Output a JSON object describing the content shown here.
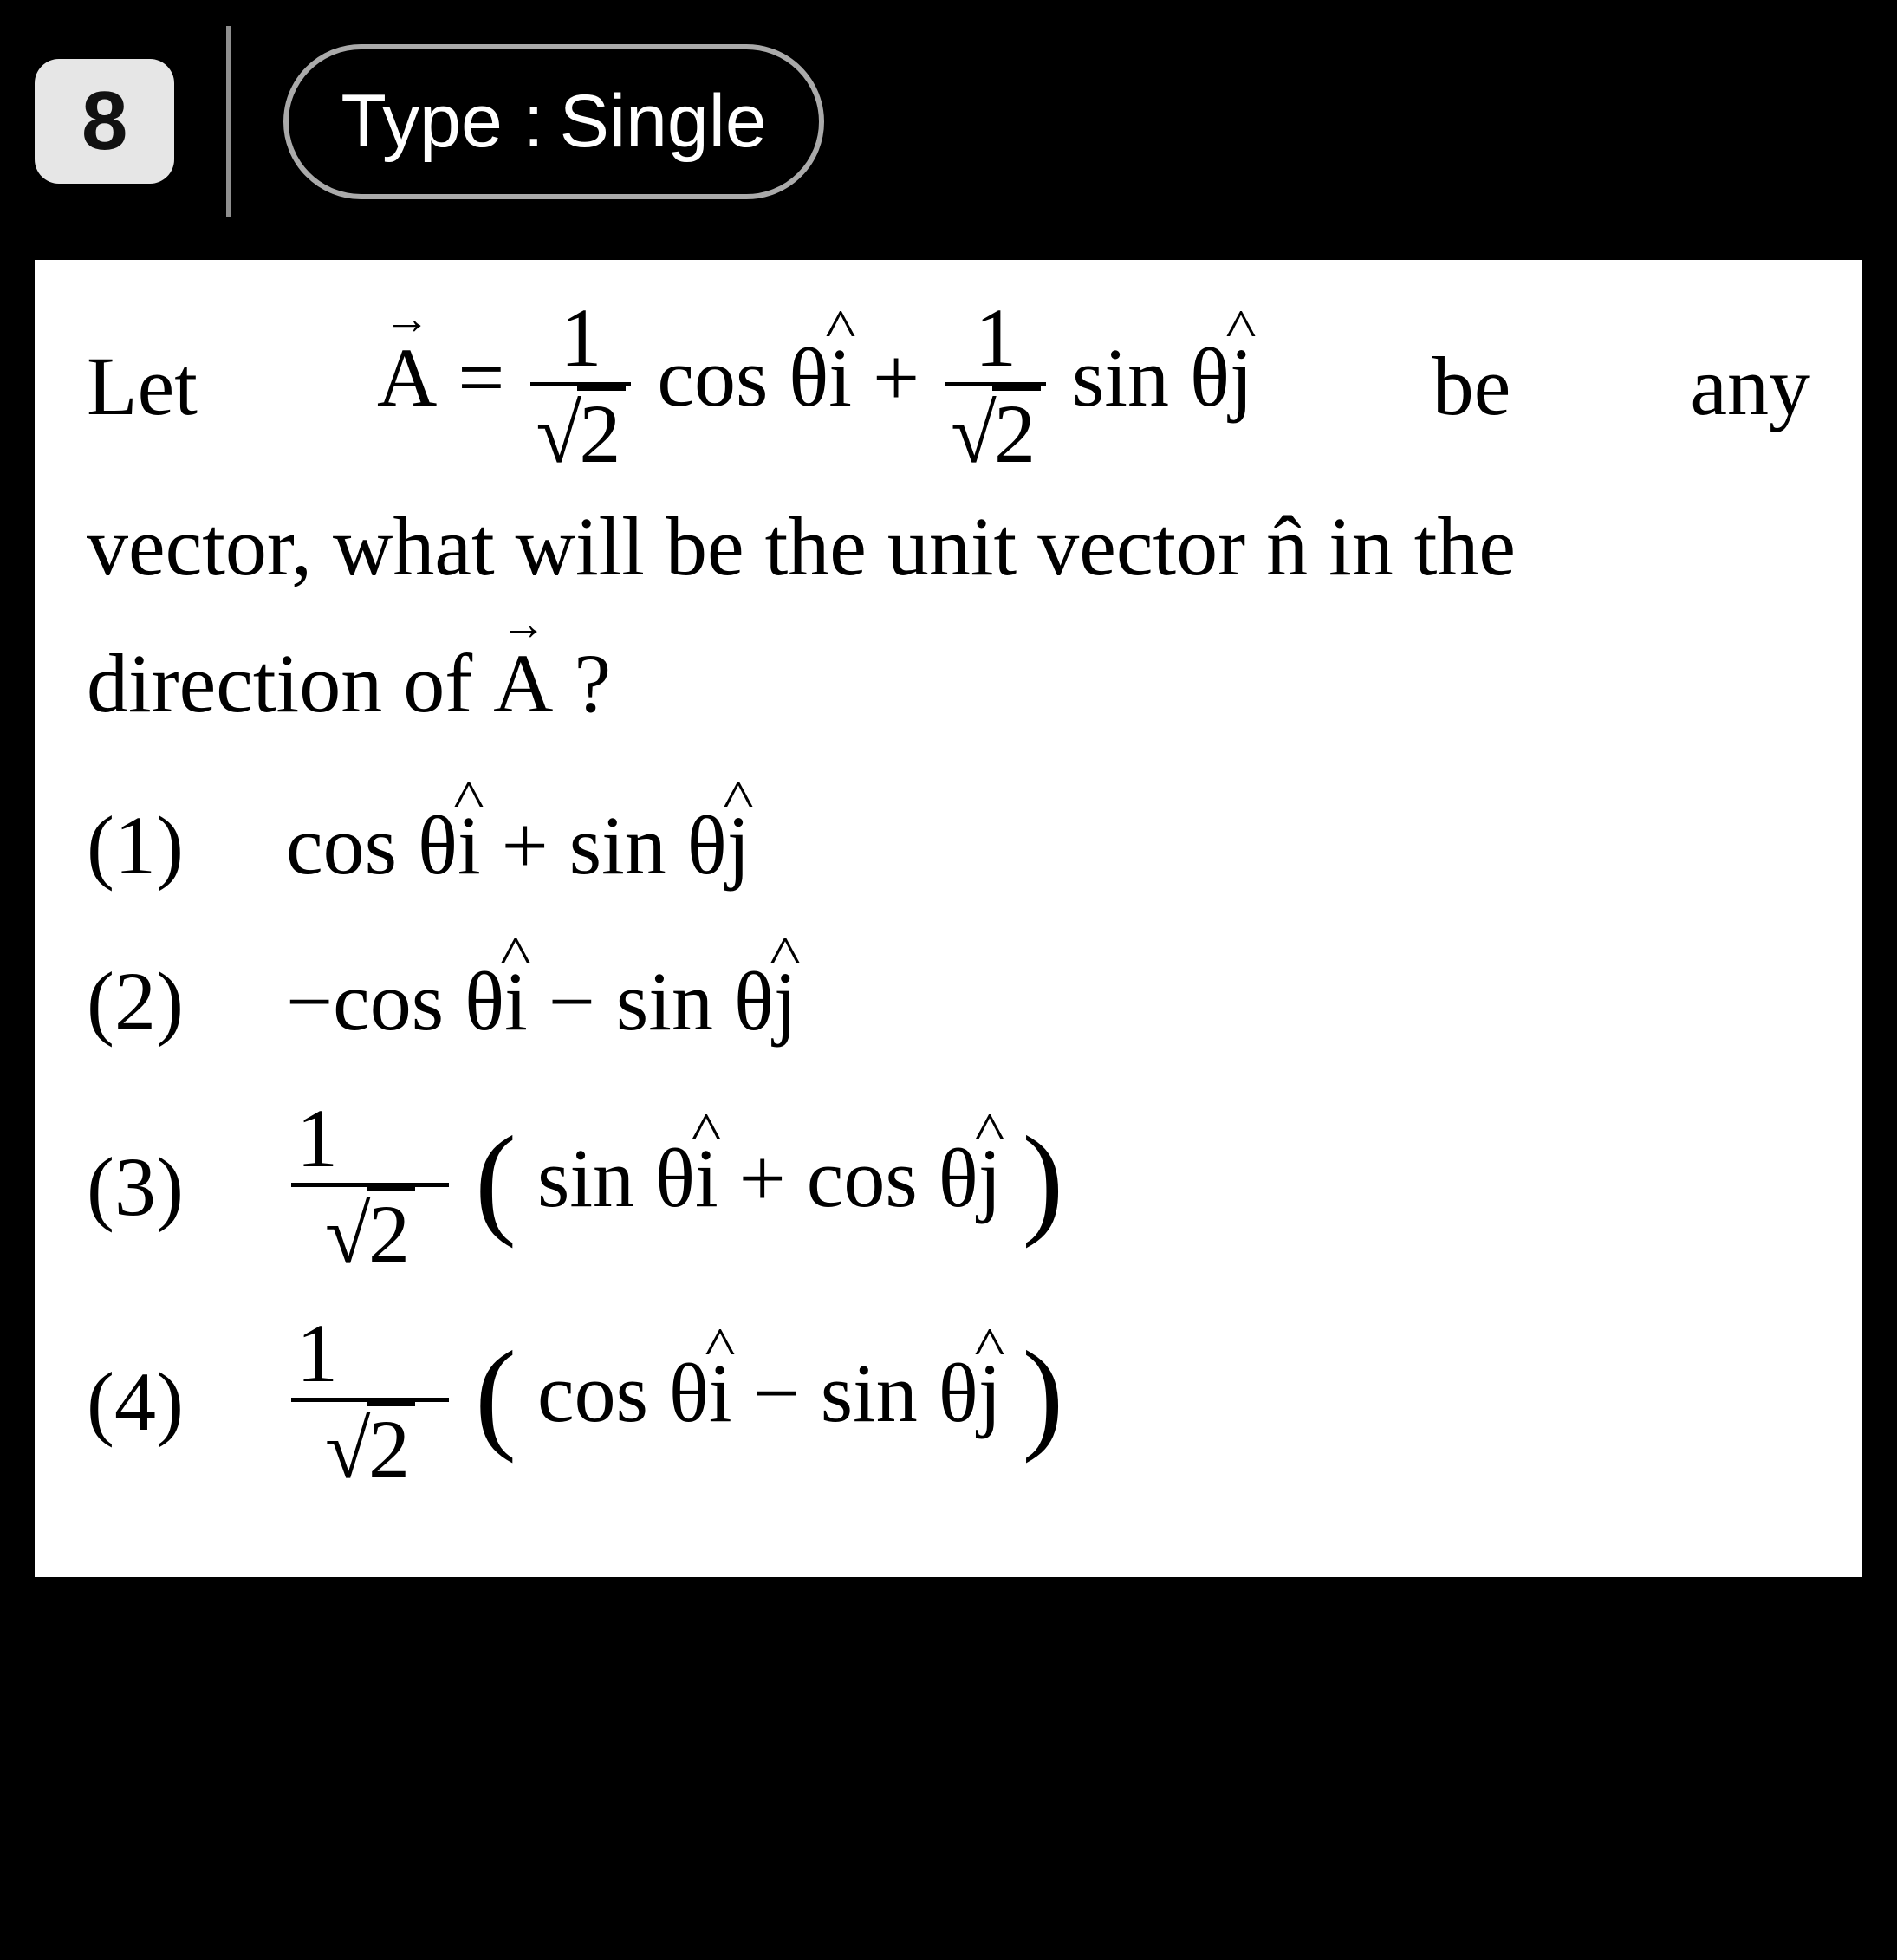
{
  "header": {
    "question_number": "8",
    "type_label": "Type :",
    "type_value": "Single"
  },
  "question": {
    "stem_line1_let": "Let",
    "stem_line1_be": "be",
    "stem_line1_any": "any",
    "vector_A_latex": "\\vec{A} = \\frac{1}{\\sqrt{2}}\\cos\\theta\\,\\hat{i} + \\frac{1}{\\sqrt{2}}\\sin\\theta\\,\\hat{j}",
    "stem_rest_before_n": "vector, what will be the unit vector ",
    "unit_vector_symbol": "n̂",
    "stem_rest_after_n": " in the direction of ",
    "stem_rest_A": "A",
    "stem_rest_qmark": " ?",
    "options": [
      {
        "num": "(1)",
        "latex": "\\cos\\theta\\,\\hat{i} + \\sin\\theta\\,\\hat{j}"
      },
      {
        "num": "(2)",
        "latex": "-\\cos\\theta\\,\\hat{i} - \\sin\\theta\\,\\hat{j}"
      },
      {
        "num": "(3)",
        "latex": "\\frac{1}{\\sqrt{2}}\\left(\\sin\\theta\\,\\hat{i} + \\cos\\theta\\,\\hat{j}\\right)"
      },
      {
        "num": "(4)",
        "latex": "\\frac{1}{\\sqrt{2}}\\left(\\cos\\theta\\,\\hat{i} - \\sin\\theta\\,\\hat{j}\\right)"
      }
    ],
    "math_tokens": {
      "one": "1",
      "two": "2",
      "equals": "=",
      "plus": "+",
      "minus": "−",
      "cos": "cos",
      "sin": "sin",
      "theta": "θ",
      "i": "i",
      "j": "j",
      "A": "A",
      "radical": "√"
    }
  }
}
